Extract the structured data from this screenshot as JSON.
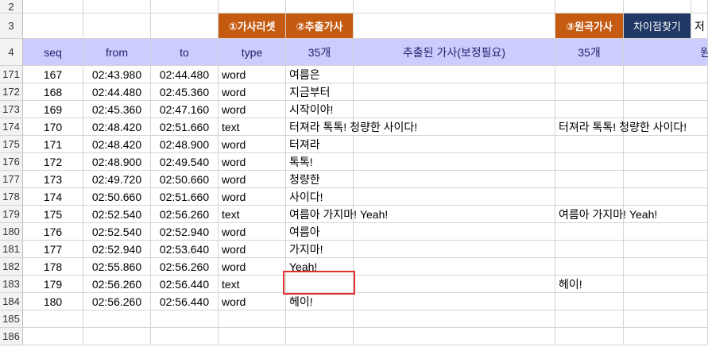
{
  "top_row": {
    "row_number": "2"
  },
  "header_row3": {
    "row_number": "3",
    "lyricset_label": "①가사리셋",
    "extract_label": "②추출가사",
    "original_label": "③원곡가사",
    "diff_label": "차이점찾기",
    "cut_label": "저"
  },
  "header_row4": {
    "row_number": "4",
    "seq": "seq",
    "from": "from",
    "to": "to",
    "type": "type",
    "extract_count": "35개",
    "extract_desc": "추출된 가사(보정필요)",
    "original_count": "35개",
    "original_desc_cut": "원"
  },
  "rows": [
    {
      "rownum": "171",
      "seq": "167",
      "from": "02:43.980",
      "to": "02:44.480",
      "type": "word",
      "lyric": "여름은",
      "original": ""
    },
    {
      "rownum": "172",
      "seq": "168",
      "from": "02:44.480",
      "to": "02:45.360",
      "type": "word",
      "lyric": "지금부터",
      "original": ""
    },
    {
      "rownum": "173",
      "seq": "169",
      "from": "02:45.360",
      "to": "02:47.160",
      "type": "word",
      "lyric": "시작이야!",
      "original": ""
    },
    {
      "rownum": "174",
      "seq": "170",
      "from": "02:48.420",
      "to": "02:51.660",
      "type": "text",
      "lyric": "터져라 톡톡! 청량한 사이다!",
      "original": "터져라 톡톡! 청량한 사이다!"
    },
    {
      "rownum": "175",
      "seq": "171",
      "from": "02:48.420",
      "to": "02:48.900",
      "type": "word",
      "lyric": "터져라",
      "original": ""
    },
    {
      "rownum": "176",
      "seq": "172",
      "from": "02:48.900",
      "to": "02:49.540",
      "type": "word",
      "lyric": "톡톡!",
      "original": ""
    },
    {
      "rownum": "177",
      "seq": "173",
      "from": "02:49.720",
      "to": "02:50.660",
      "type": "word",
      "lyric": "청량한",
      "original": ""
    },
    {
      "rownum": "178",
      "seq": "174",
      "from": "02:50.660",
      "to": "02:51.660",
      "type": "word",
      "lyric": "사이다!",
      "original": ""
    },
    {
      "rownum": "179",
      "seq": "175",
      "from": "02:52.540",
      "to": "02:56.260",
      "type": "text",
      "lyric": "여름아 가지마! Yeah!",
      "original": "여름아 가지마! Yeah!"
    },
    {
      "rownum": "180",
      "seq": "176",
      "from": "02:52.540",
      "to": "02:52.940",
      "type": "word",
      "lyric": "여름아",
      "original": ""
    },
    {
      "rownum": "181",
      "seq": "177",
      "from": "02:52.940",
      "to": "02:53.640",
      "type": "word",
      "lyric": "가지마!",
      "original": ""
    },
    {
      "rownum": "182",
      "seq": "178",
      "from": "02:55.860",
      "to": "02:56.260",
      "type": "word",
      "lyric": "Yeah!",
      "original": ""
    },
    {
      "rownum": "183",
      "seq": "179",
      "from": "02:56.260",
      "to": "02:56.440",
      "type": "text",
      "lyric": "",
      "original": "헤이!"
    },
    {
      "rownum": "184",
      "seq": "180",
      "from": "02:56.260",
      "to": "02:56.440",
      "type": "word",
      "lyric": "헤이!",
      "original": ""
    }
  ],
  "empty_rows": [
    "185",
    "186"
  ],
  "colors": {
    "header_blue": "#ccccff",
    "button_orange": "#c55a11",
    "button_navy": "#1f3864",
    "highlight_red": "#e03030"
  }
}
